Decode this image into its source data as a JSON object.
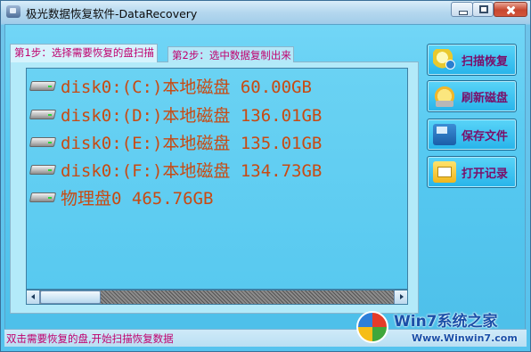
{
  "window": {
    "title": "极光数据恢复软件-DataRecovery"
  },
  "tabs": [
    {
      "label": "第1步：选择需要恢复的盘扫描",
      "active": true
    },
    {
      "label": "第2步：选中数据复制出来",
      "active": false
    }
  ],
  "disks": [
    {
      "label": "disk0:(C:)本地磁盘 60.00GB",
      "icon": "hard-drive-icon"
    },
    {
      "label": "disk0:(D:)本地磁盘 136.01GB",
      "icon": "hard-drive-icon"
    },
    {
      "label": "disk0:(E:)本地磁盘 135.01GB",
      "icon": "hard-drive-icon"
    },
    {
      "label": "disk0:(F:)本地磁盘 134.73GB",
      "icon": "hard-drive-icon"
    },
    {
      "label": "物理盘0 465.76GB",
      "icon": "hard-drive-icon"
    }
  ],
  "buttons": {
    "scan": {
      "label": "扫描恢复",
      "icon": "magnifier-icon"
    },
    "refresh": {
      "label": "刷新磁盘",
      "icon": "refresh-disk-icon"
    },
    "save": {
      "label": "保存文件",
      "icon": "save-file-icon"
    },
    "open_log": {
      "label": "打开记录",
      "icon": "open-log-icon"
    }
  },
  "status": {
    "text": "双击需要恢复的盘,开始扫描恢复数据"
  },
  "watermark": {
    "title": "Win7系统之家",
    "url": "Www.Winwin7.com"
  },
  "colors": {
    "disk_text": "#c84a12",
    "tab_text": "#c0006e",
    "button_text": "#7a0f6a",
    "panel_bg": "#58c9f0"
  }
}
